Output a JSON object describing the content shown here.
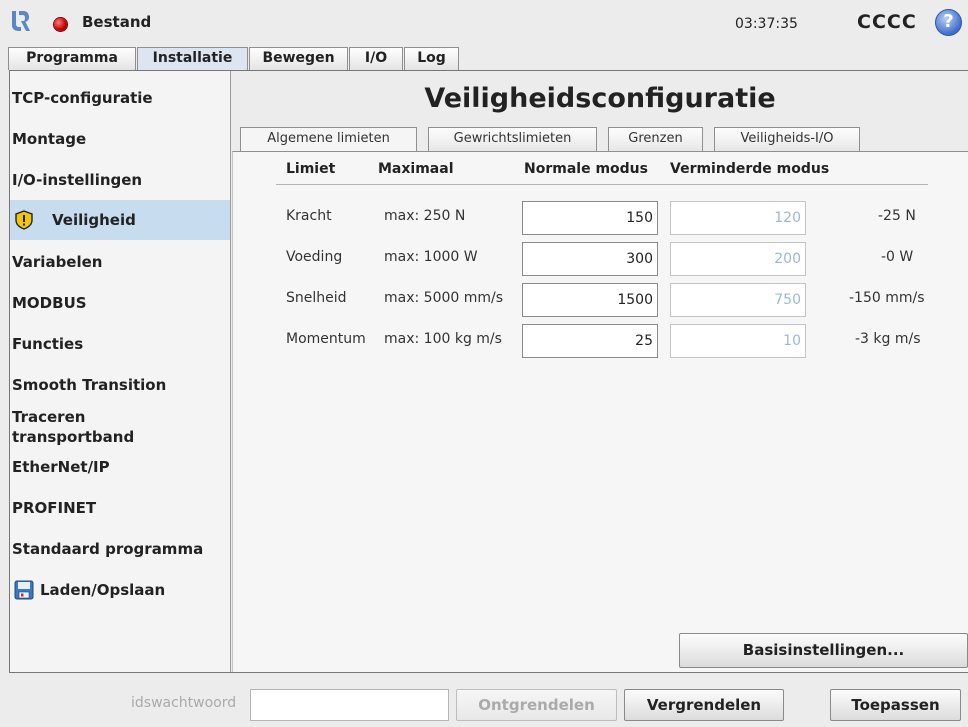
{
  "titlebar": {
    "file_title": "Bestand",
    "clock": "03:37:35",
    "robot_name": "CCCC",
    "help_glyph": "?"
  },
  "main_tabs": [
    {
      "label": "Programma"
    },
    {
      "label": "Installatie",
      "active": true
    },
    {
      "label": "Bewegen"
    },
    {
      "label": "I/O"
    },
    {
      "label": "Log"
    }
  ],
  "sidebar": {
    "items": [
      {
        "label": "TCP-configuratie"
      },
      {
        "label": "Montage"
      },
      {
        "label": "I/O-instellingen"
      },
      {
        "label": "Veiligheid",
        "icon": "warning-shield-icon",
        "active": true
      },
      {
        "label": "Variabelen"
      },
      {
        "label": "MODBUS"
      },
      {
        "label": "Functies"
      },
      {
        "label": "Smooth Transition"
      },
      {
        "label_line1": "Traceren",
        "label_line2": "transportband"
      },
      {
        "label": "EtherNet/IP"
      },
      {
        "label": "PROFINET"
      },
      {
        "label": "Standaard programma"
      },
      {
        "label": "Laden/Opslaan",
        "icon": "floppy-disk-icon"
      }
    ]
  },
  "main": {
    "title": "Veiligheidsconfiguratie",
    "sub_tabs": [
      {
        "label": "Algemene limieten",
        "active": true
      },
      {
        "label": "Gewrichtslimieten"
      },
      {
        "label": "Grenzen"
      },
      {
        "label": "Veiligheids-I/O"
      }
    ],
    "table": {
      "headers": {
        "limit": "Limiet",
        "max": "Maximaal",
        "normal": "Normale modus",
        "reduced": "Verminderde modus"
      },
      "rows": [
        {
          "name": "Kracht",
          "max": "max: 250 N",
          "normal": "150",
          "reduced": "120",
          "diff": "-25 N"
        },
        {
          "name": "Voeding",
          "max": "max: 1000 W",
          "normal": "300",
          "reduced": "200",
          "diff": "-0 W"
        },
        {
          "name": "Snelheid",
          "max": "max: 5000 mm/s",
          "normal": "1500",
          "reduced": "750",
          "diff": "-150 mm/s"
        },
        {
          "name": "Momentum",
          "max": "max: 100 kg m/s",
          "normal": "25",
          "reduced": "10",
          "diff": "-3 kg m/s"
        }
      ]
    },
    "basis_button": "Basisinstellingen..."
  },
  "bottom": {
    "password_label": "idswachtwoord",
    "password_value": "",
    "unlock": "Ontgrendelen",
    "lock": "Vergrendelen",
    "apply": "Toepassen"
  },
  "colors": {
    "accent_selected": "#c8dcf0",
    "status_red": "#c00000",
    "help_blue": "#3f6fcc"
  }
}
